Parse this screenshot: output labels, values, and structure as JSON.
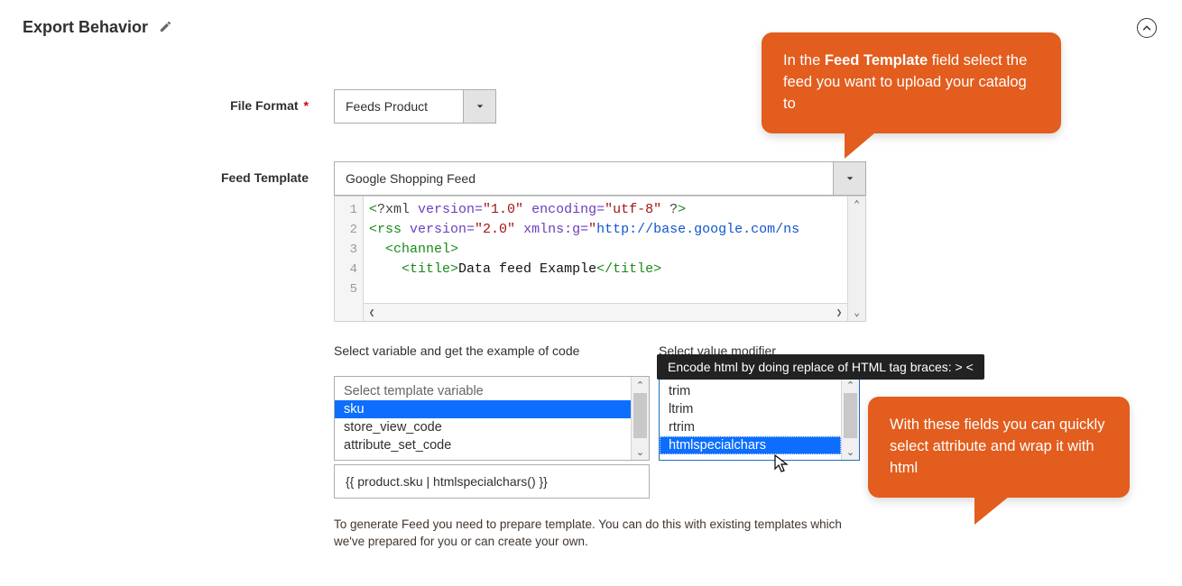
{
  "section": {
    "title": "Export Behavior"
  },
  "file_format": {
    "label": "File Format",
    "value": "Feeds Product",
    "required": true
  },
  "feed_template": {
    "label": "Feed Template",
    "value": "Google Shopping Feed",
    "code_lines": [
      {
        "n": 1,
        "segs": [
          {
            "cls": "tok-br",
            "t": "<"
          },
          {
            "cls": "tok-xml",
            "t": "?xml "
          },
          {
            "cls": "tok-attr",
            "t": "version="
          },
          {
            "cls": "tok-str",
            "t": "\"1.0\""
          },
          {
            "cls": "tok-xml",
            "t": " "
          },
          {
            "cls": "tok-attr",
            "t": "encoding="
          },
          {
            "cls": "tok-str",
            "t": "\"utf-8\""
          },
          {
            "cls": "tok-xml",
            "t": " ?"
          },
          {
            "cls": "tok-br",
            "t": ">"
          }
        ]
      },
      {
        "n": 2,
        "segs": [
          {
            "cls": "tok-br",
            "t": "<"
          },
          {
            "cls": "tok-tag",
            "t": "rss "
          },
          {
            "cls": "tok-attr",
            "t": "version="
          },
          {
            "cls": "tok-str",
            "t": "\"2.0\""
          },
          {
            "cls": "tok-tag",
            "t": " "
          },
          {
            "cls": "tok-attr",
            "t": "xmlns:g="
          },
          {
            "cls": "tok-str",
            "t": "\""
          },
          {
            "cls": "tok-link",
            "t": "http://base.google.com/ns"
          }
        ]
      },
      {
        "n": 3,
        "indent": 2,
        "segs": [
          {
            "cls": "tok-br",
            "t": "<"
          },
          {
            "cls": "tok-tag",
            "t": "channel"
          },
          {
            "cls": "tok-br",
            "t": ">"
          }
        ]
      },
      {
        "n": 4,
        "indent": 4,
        "segs": [
          {
            "cls": "tok-br",
            "t": "<"
          },
          {
            "cls": "tok-tag",
            "t": "title"
          },
          {
            "cls": "tok-br",
            "t": ">"
          },
          {
            "cls": "tok-txt",
            "t": "Data feed Example"
          },
          {
            "cls": "tok-br",
            "t": "</"
          },
          {
            "cls": "tok-tag",
            "t": "title"
          },
          {
            "cls": "tok-br",
            "t": ">"
          }
        ]
      },
      {
        "n": 5,
        "segs": []
      }
    ],
    "variable_label": "Select variable and get the example of code",
    "modifier_label": "Select value modifier",
    "variables": [
      {
        "text": "Select template variable",
        "muted": true
      },
      {
        "text": "sku",
        "selected": true
      },
      {
        "text": "store_view_code"
      },
      {
        "text": "attribute_set_code"
      }
    ],
    "modifiers": [
      {
        "text": "trim"
      },
      {
        "text": "ltrim"
      },
      {
        "text": "rtrim"
      },
      {
        "text": "htmlspecialchars",
        "selected": true
      }
    ],
    "code_sample": "{{ product.sku  | htmlspecialchars() }}",
    "note": "To generate Feed you need to prepare template. You can do this with existing templates which we've prepared for you or can create your own."
  },
  "tooltip": "Encode html by doing replace of HTML tag braces: > <",
  "callout1_prefix": "In the ",
  "callout1_bold": "Feed Template",
  "callout1_suffix": " field select the feed you want to upload your catalog to",
  "callout2": "With these fields you can quickly select attribute and wrap it with html"
}
